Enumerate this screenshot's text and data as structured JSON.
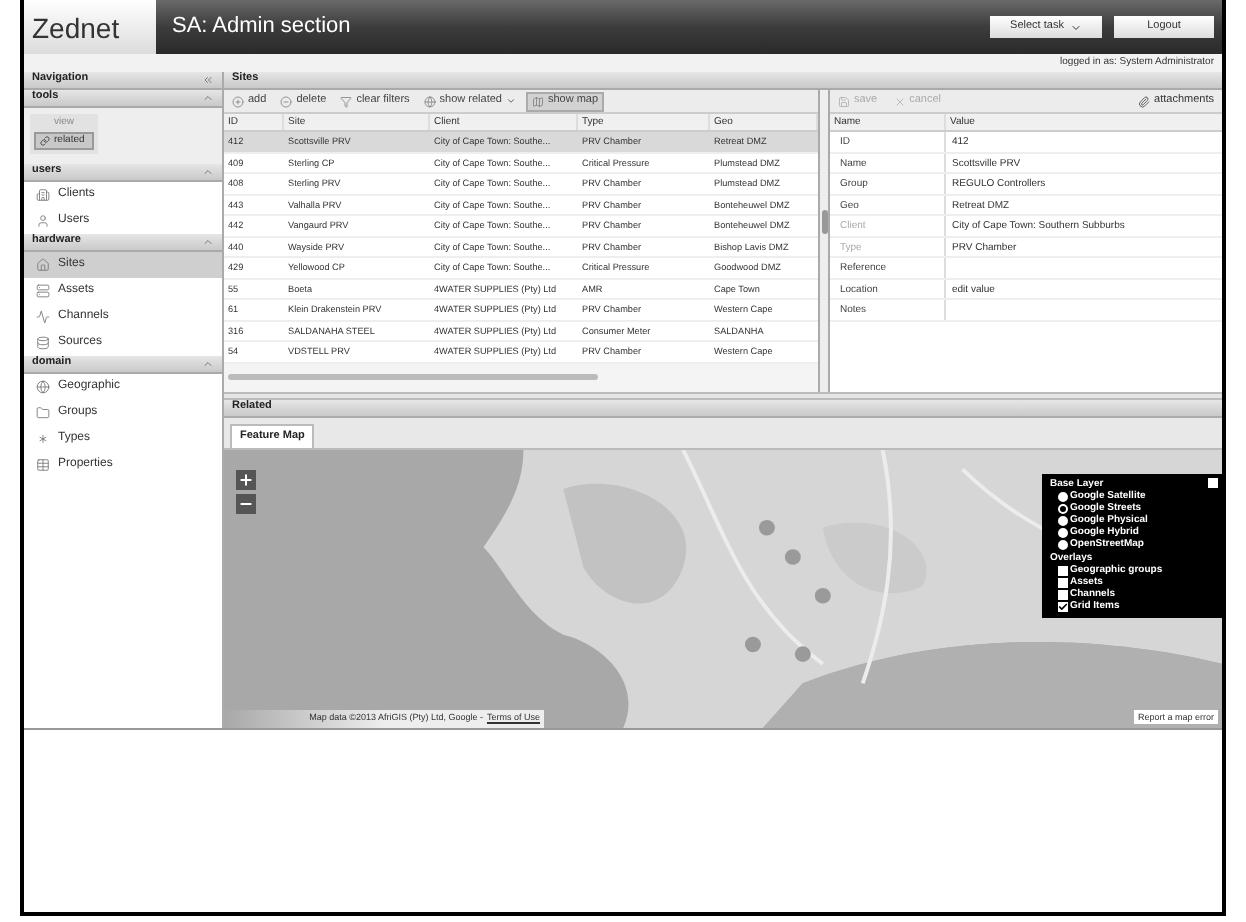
{
  "header": {
    "logo": "Zednet",
    "title": "SA: Admin section",
    "task_select": "Select task",
    "logout": "Logout",
    "logged_in": "logged in as: System Administrator"
  },
  "navigation": {
    "title": "Navigation",
    "sections": [
      {
        "kind": "tools",
        "title": "tools",
        "group": "view",
        "buttons": [
          {
            "label": "related",
            "selected": true
          }
        ]
      },
      {
        "kind": "list",
        "title": "users",
        "items": [
          {
            "label": "Clients",
            "kind": "clients",
            "selected": false
          },
          {
            "label": "Users",
            "kind": "users",
            "selected": false
          }
        ]
      },
      {
        "kind": "list",
        "title": "hardware",
        "items": [
          {
            "label": "Sites",
            "kind": "sites",
            "selected": true
          },
          {
            "label": "Assets",
            "kind": "assets",
            "selected": false
          },
          {
            "label": "Channels",
            "kind": "channels",
            "selected": false
          },
          {
            "label": "Sources",
            "kind": "sources",
            "selected": false
          }
        ]
      },
      {
        "kind": "list",
        "title": "domain",
        "items": [
          {
            "label": "Geographic",
            "kind": "geographic",
            "selected": false
          },
          {
            "label": "Groups",
            "kind": "groups",
            "selected": false
          },
          {
            "label": "Types",
            "kind": "types",
            "selected": false
          },
          {
            "label": "Properties",
            "kind": "properties",
            "selected": false
          }
        ]
      }
    ]
  },
  "sites": {
    "title": "Sites",
    "toolbar": [
      {
        "label": "add",
        "kind": "add",
        "selected": false,
        "has_menu": false
      },
      {
        "label": "delete",
        "kind": "delete",
        "selected": false,
        "has_menu": false
      },
      {
        "label": "clear filters",
        "kind": "clear",
        "selected": false,
        "has_menu": false
      },
      {
        "label": "show related",
        "kind": "related",
        "selected": false,
        "has_menu": true
      },
      {
        "label": "show map",
        "kind": "map",
        "selected": true,
        "has_menu": false
      }
    ],
    "columns": [
      "ID",
      "Site",
      "Client",
      "Type",
      "Geo"
    ],
    "rows": [
      {
        "cells": [
          "412",
          "Scottsville PRV",
          "City of Cape Town: Southe...",
          "PRV Chamber",
          "Retreat DMZ"
        ],
        "selected": true
      },
      {
        "cells": [
          "409",
          "Sterling CP",
          "City of Cape Town: Southe...",
          "Critical Pressure",
          "Plumstead DMZ"
        ],
        "selected": false
      },
      {
        "cells": [
          "408",
          "Sterling PRV",
          "City of Cape Town: Southe...",
          "PRV Chamber",
          "Plumstead DMZ"
        ],
        "selected": false
      },
      {
        "cells": [
          "443",
          "Valhalla PRV",
          "City of Cape Town: Southe...",
          "PRV Chamber",
          "Bonteheuwel DMZ"
        ],
        "selected": false
      },
      {
        "cells": [
          "442",
          "Vangaurd PRV",
          "City of Cape Town: Southe...",
          "PRV Chamber",
          "Bonteheuwel DMZ"
        ],
        "selected": false
      },
      {
        "cells": [
          "440",
          "Wayside PRV",
          "City of Cape Town: Southe...",
          "PRV Chamber",
          "Bishop Lavis DMZ"
        ],
        "selected": false
      },
      {
        "cells": [
          "429",
          "Yellowood CP",
          "City of Cape Town: Southe...",
          "Critical Pressure",
          "Goodwood DMZ"
        ],
        "selected": false
      },
      {
        "cells": [
          "55",
          "Boeta",
          "4WATER SUPPLIES (Pty) Ltd",
          "AMR",
          "Cape Town"
        ],
        "selected": false
      },
      {
        "cells": [
          "61",
          "Klein Drakenstein PRV",
          "4WATER SUPPLIES (Pty) Ltd",
          "PRV Chamber",
          "Western Cape"
        ],
        "selected": false
      },
      {
        "cells": [
          "316",
          "SALDANAHA STEEL",
          "4WATER SUPPLIES (Pty) Ltd",
          "Consumer Meter",
          "SALDANHA"
        ],
        "selected": false
      },
      {
        "cells": [
          "54",
          "VDSTELL PRV",
          "4WATER SUPPLIES (Pty) Ltd",
          "PRV Chamber",
          "Western Cape"
        ],
        "selected": false
      }
    ]
  },
  "details": {
    "toolbar": [
      {
        "label": "save",
        "kind": "save",
        "disabled": true
      },
      {
        "label": "cancel",
        "kind": "cancel",
        "disabled": true
      },
      {
        "label": "attachments",
        "kind": "attach",
        "disabled": false
      }
    ],
    "columns": [
      "Name",
      "Value"
    ],
    "rows": [
      {
        "name": "ID",
        "value": "412",
        "disabled": false
      },
      {
        "name": "Name",
        "value": "Scottsville PRV",
        "disabled": false
      },
      {
        "name": "Group",
        "value": "REGULO Controllers",
        "disabled": false
      },
      {
        "name": "Geo",
        "value": "Retreat DMZ",
        "disabled": false
      },
      {
        "name": "Client",
        "value": "City of Cape Town: Southern Subburbs",
        "disabled": true
      },
      {
        "name": "Type",
        "value": "PRV Chamber",
        "disabled": true
      },
      {
        "name": "Reference",
        "disabled": false
      },
      {
        "name": "Location",
        "value": "edit value",
        "disabled": false
      },
      {
        "name": "Notes",
        "disabled": false
      }
    ]
  },
  "related": {
    "title": "Related",
    "tabs": [
      {
        "label": "Feature Map",
        "selected": true
      }
    ],
    "map": {
      "kind": "picture",
      "attribution": "Map data ©2013 AfriGIS (Pty) Ltd, Google -",
      "terms_link": "Terms of Use",
      "report": "Report a map error",
      "layers": {
        "base_title": "Base Layer",
        "base": [
          {
            "label": "Google Satellite",
            "selected": false
          },
          {
            "label": "Google Streets",
            "selected": true
          },
          {
            "label": "Google Physical",
            "selected": false
          },
          {
            "label": "Google Hybrid",
            "selected": false
          },
          {
            "label": "OpenStreetMap",
            "selected": false
          }
        ],
        "overlays_title": "Overlays",
        "overlays": [
          {
            "label": "Geographic groups",
            "checked": false
          },
          {
            "label": "Assets",
            "checked": false
          },
          {
            "label": "Channels",
            "checked": false
          },
          {
            "label": "Grid Items",
            "checked": true
          }
        ]
      }
    }
  }
}
